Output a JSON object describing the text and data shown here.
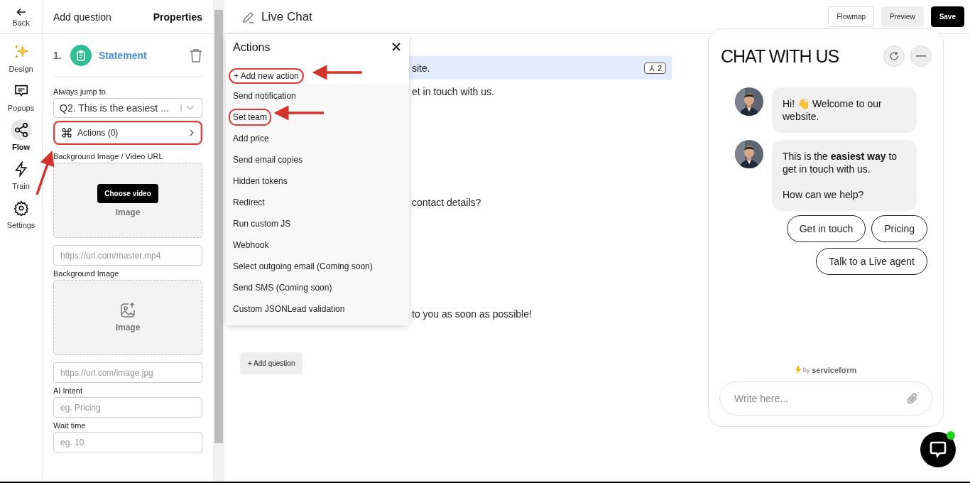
{
  "rail": {
    "back": "Back",
    "items": [
      {
        "label": "Design",
        "kind": "sparkle",
        "selected": false
      },
      {
        "label": "Popups",
        "kind": "chat",
        "selected": false
      },
      {
        "label": "Flow",
        "kind": "share",
        "selected": true
      },
      {
        "label": "Train",
        "kind": "bolt",
        "selected": false
      },
      {
        "label": "Settings",
        "kind": "gear",
        "selected": false
      }
    ]
  },
  "panel": {
    "tabs": [
      {
        "label": "Add question",
        "selected": false
      },
      {
        "label": "Properties",
        "selected": true
      }
    ],
    "question": {
      "number": "1.",
      "type": "Statement"
    },
    "jump_label": "Always jump to",
    "jump_value": "Q2. This is the easiest ...",
    "actions_button": {
      "label": "Actions (0)",
      "highlighted": true
    },
    "video_label": "Background Image / Video URL",
    "video_button": "Choose video",
    "video_caption": "Image",
    "video_url_placeholder": "https://url.com/master.mp4",
    "image_label": "Background Image",
    "image_caption": "Image",
    "image_url_placeholder": "https://url.com/image.jpg",
    "intent_label": "AI Intent",
    "intent_placeholder": "eg. Pricing",
    "wait_label": "Wait time",
    "wait_placeholder": "eg. 10"
  },
  "header": {
    "title": "Live Chat",
    "buttons": [
      {
        "label": "Flowmap",
        "kind": "outline"
      },
      {
        "label": "Preview",
        "kind": "soft"
      },
      {
        "label": "Save",
        "kind": "primary"
      }
    ]
  },
  "canvas": {
    "rows": [
      {
        "text": "site.",
        "selected": true,
        "badge": "2"
      },
      {
        "text": "et in touch with us.",
        "selected": false
      },
      {
        "text": "contact details?",
        "selected": false
      },
      {
        "text": "to you as soon as possible!",
        "selected": false
      }
    ],
    "add_question": "+ Add question"
  },
  "actions_popup": {
    "title": "Actions",
    "add_new": {
      "label": "+ Add new action",
      "highlighted": true
    },
    "items": [
      {
        "label": "Send notification",
        "highlighted": false
      },
      {
        "label": "Set team",
        "highlighted": true
      },
      {
        "label": "Add price",
        "highlighted": false
      },
      {
        "label": "Send email copies",
        "highlighted": false
      },
      {
        "label": "Hidden tokens",
        "highlighted": false
      },
      {
        "label": "Redirect",
        "highlighted": false
      },
      {
        "label": "Run custom JS",
        "highlighted": false
      },
      {
        "label": "Webhook",
        "highlighted": false
      },
      {
        "label": "Select outgoing email (Coming soon)",
        "highlighted": false
      },
      {
        "label": "Send SMS (Coming soon)",
        "highlighted": false
      },
      {
        "label": "Custom JSONLead validation",
        "highlighted": false
      }
    ]
  },
  "chat": {
    "title": "CHAT WITH US",
    "messages": [
      {
        "text": "Hi! 👋 Welcome to our website."
      },
      {
        "text": "This is the **easiest way** to get in touch with us.\n\nHow can we help?"
      }
    ],
    "quick_replies": [
      "Get in touch",
      "Pricing",
      "Talk to a Live agent"
    ],
    "branding_by": "by",
    "branding_name": "servicefσrm",
    "input_placeholder": "Write here...",
    "online": true
  }
}
